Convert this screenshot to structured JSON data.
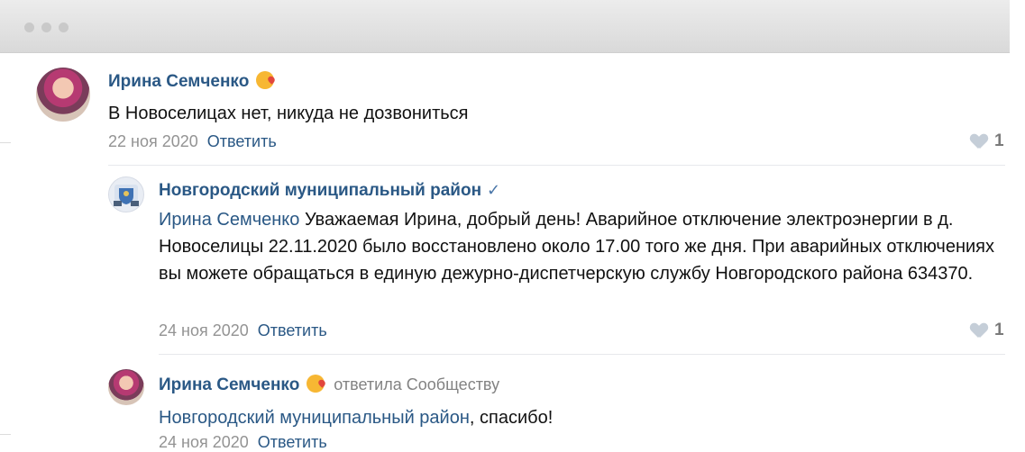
{
  "comments": [
    {
      "author": "Ирина Семченко",
      "text": "В Новоселицах нет, никуда не дозвониться",
      "date": "22 ноя 2020",
      "reply_label": "Ответить",
      "likes": "1"
    },
    {
      "author": "Новгородский муниципальный район",
      "mention": "Ирина Семченко",
      "text": " Уважаемая Ирина, добрый день! Аварийное отключение электроэнергии в д. Новоселицы 22.11.2020 было восстановлено около 17.00 того же дня. При аварийных отключениях вы можете обращаться в единую дежурно-диспетчерскую службу Новгородского района 634370.",
      "date": "24 ноя 2020",
      "reply_label": "Ответить",
      "likes": "1"
    },
    {
      "author": "Ирина Семченко",
      "reply_meta": "ответила Сообществу",
      "mention": "Новгородский муниципальный район",
      "text": ", спасибо!",
      "date": "24 ноя 2020",
      "reply_label": "Ответить"
    }
  ]
}
